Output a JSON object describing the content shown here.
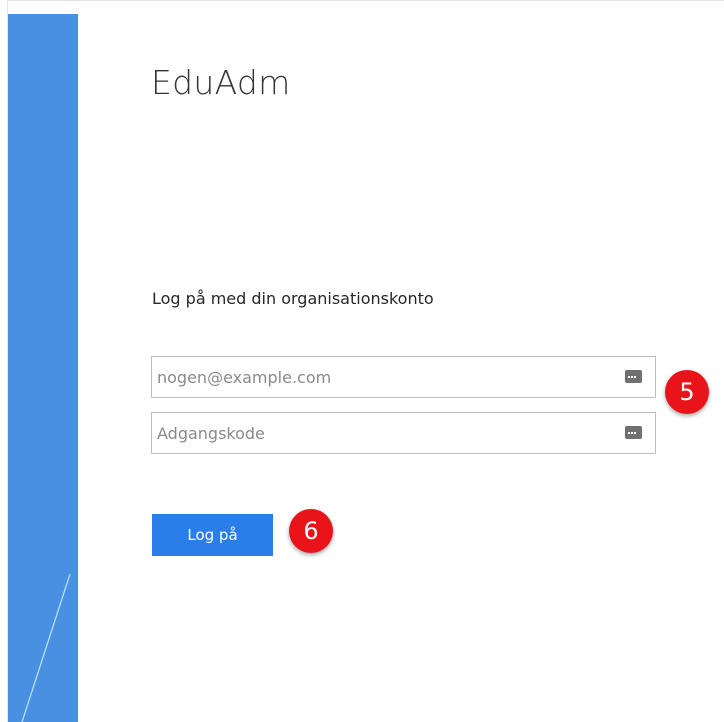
{
  "app": {
    "title": "EduAdm"
  },
  "form": {
    "heading": "Log på med din organisationskonto",
    "email_placeholder": "nogen@example.com",
    "password_placeholder": "Adgangskode",
    "submit_label": "Log på"
  },
  "annotations": {
    "step_fields": "5",
    "step_button": "6"
  },
  "icons": {
    "field_icon": "password-dots-icon"
  },
  "colors": {
    "side_panel": "#4a90e2",
    "button": "#2b7de9",
    "badge": "#e8141a"
  }
}
